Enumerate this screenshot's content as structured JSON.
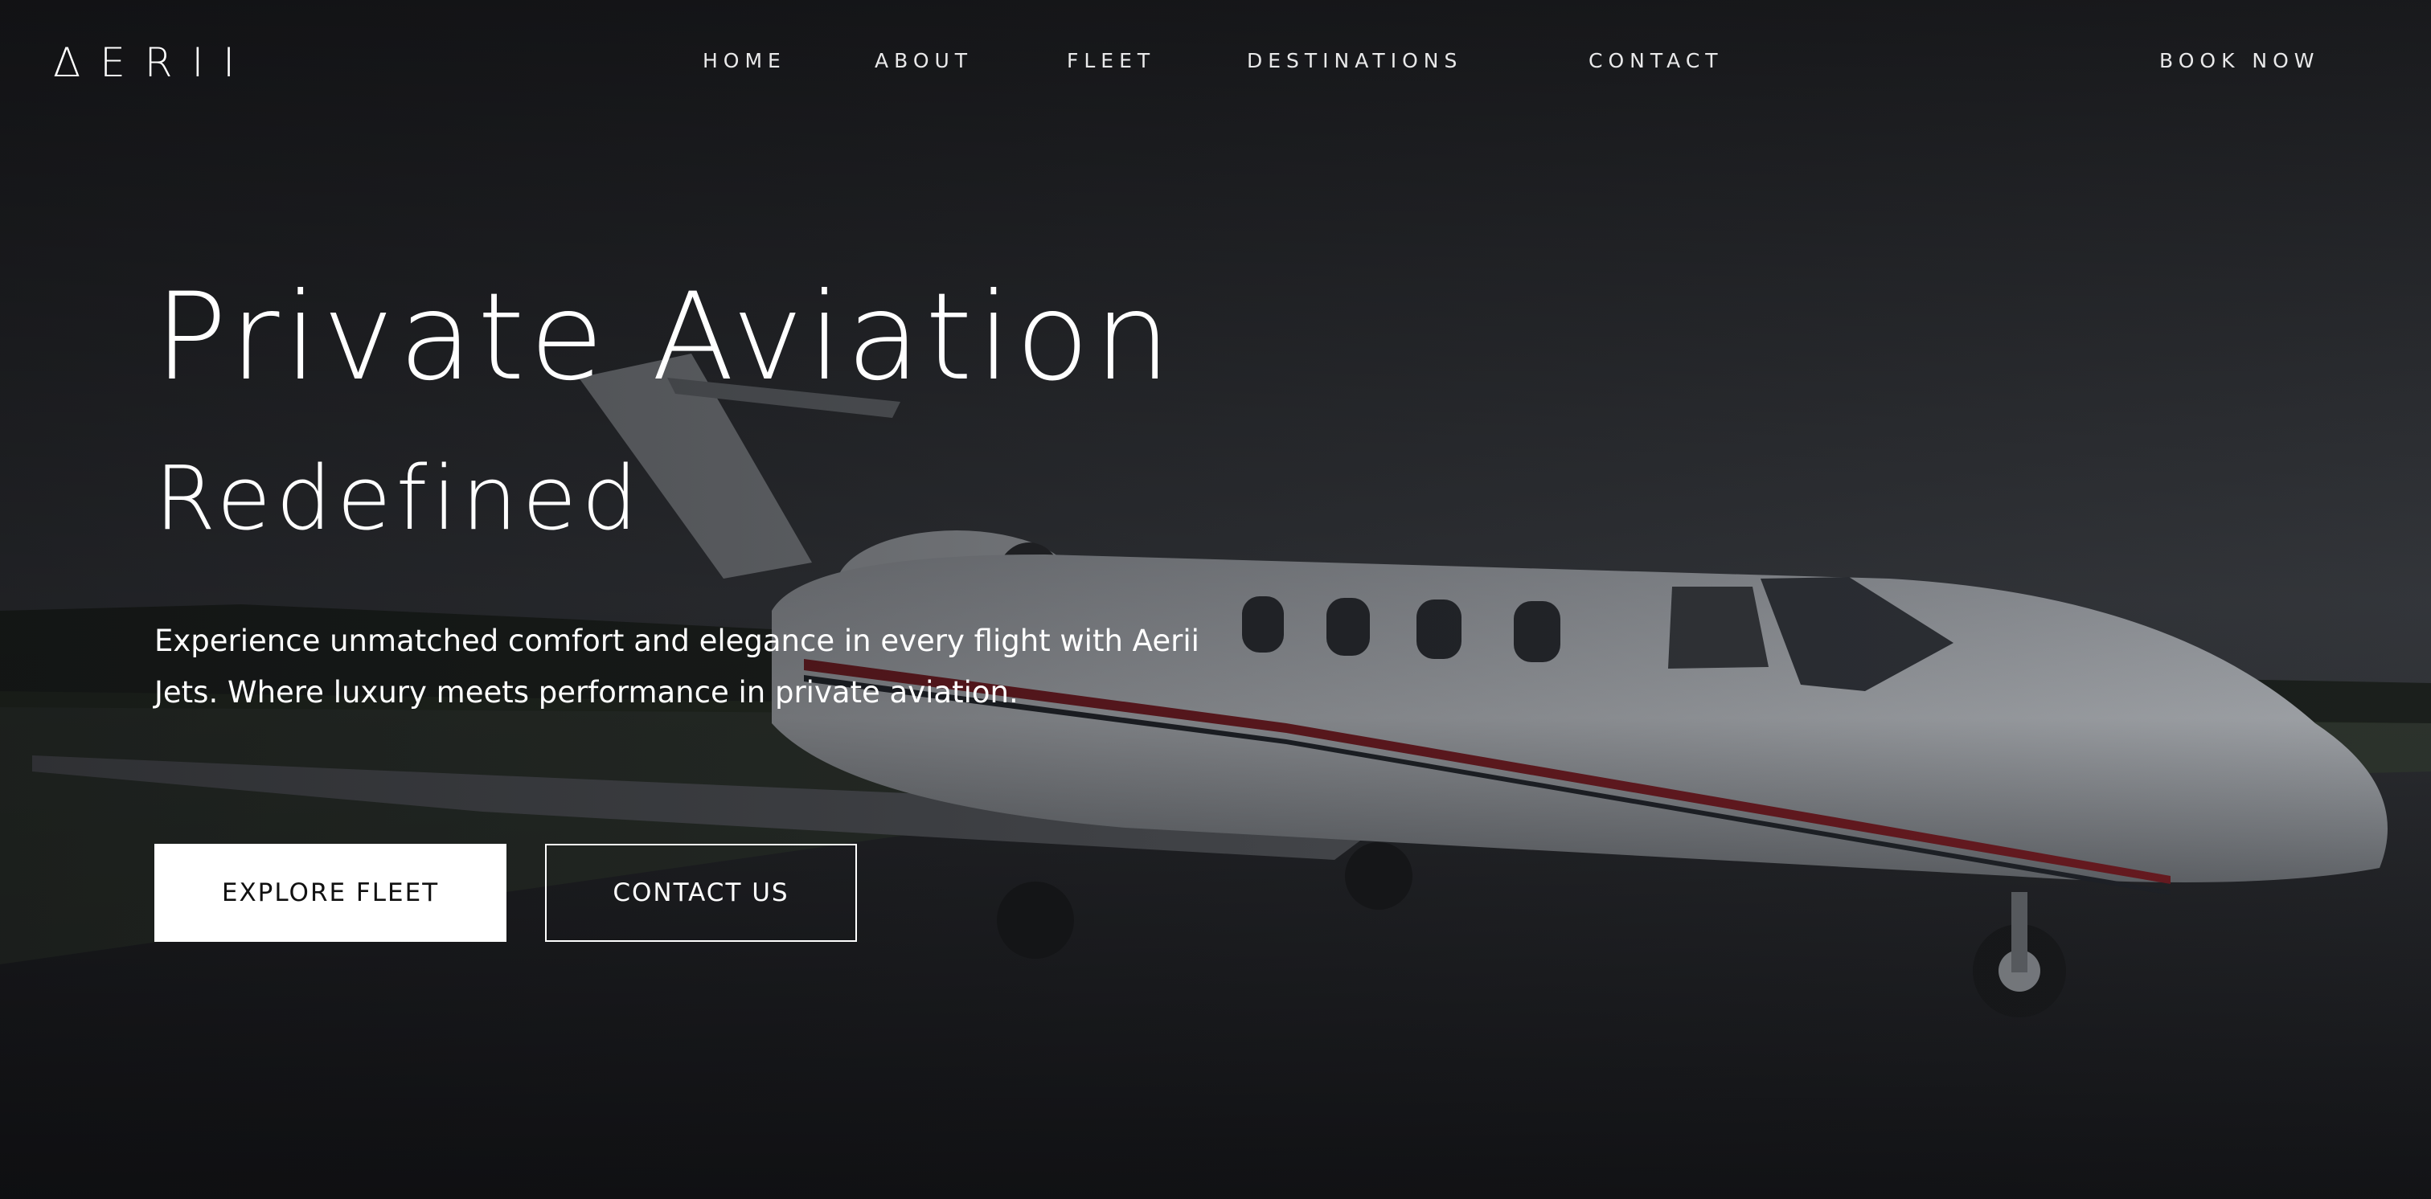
{
  "brand": {
    "logo": "ΔERII"
  },
  "nav": {
    "items": [
      {
        "label": "HOME"
      },
      {
        "label": "ABOUT"
      },
      {
        "label": "FLEET"
      },
      {
        "label": "DESTINATIONS"
      },
      {
        "label": "CONTACT"
      }
    ],
    "cta": "BOOK NOW"
  },
  "hero": {
    "headline": "Private Aviation",
    "subheadline": "Redefined",
    "description": "Experience unmatched comfort and elegance in every flight with Aerii Jets. Where luxury meets performance in private aviation.",
    "primary_button": "EXPLORE FLEET",
    "secondary_button": "CONTACT US",
    "background_image": "private-jet-on-tarmac"
  },
  "colors": {
    "text": "#ffffff",
    "primary_button_bg": "#ffffff",
    "primary_button_text": "#111111",
    "overlay": "#111214"
  }
}
